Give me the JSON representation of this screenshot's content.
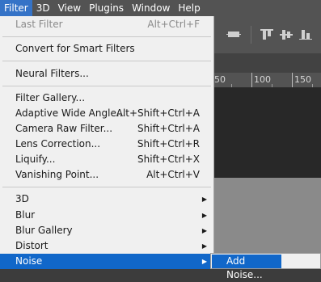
{
  "menubar": {
    "items": [
      "Filter",
      "3D",
      "View",
      "Plugins",
      "Window",
      "Help"
    ],
    "active": "Filter"
  },
  "ruler": {
    "labels": [
      "50",
      "100",
      "150"
    ]
  },
  "filter_menu": {
    "last_filter": {
      "label": "Last Filter",
      "shortcut": "Alt+Ctrl+F",
      "disabled": true
    },
    "convert_smart": {
      "label": "Convert for Smart Filters"
    },
    "neural_filters": {
      "label": "Neural Filters..."
    },
    "filter_gallery": {
      "label": "Filter Gallery..."
    },
    "adaptive_wide_angle": {
      "label": "Adaptive Wide Angle...",
      "shortcut": "Alt+Shift+Ctrl+A"
    },
    "camera_raw": {
      "label": "Camera Raw Filter...",
      "shortcut": "Shift+Ctrl+A"
    },
    "lens_correction": {
      "label": "Lens Correction...",
      "shortcut": "Shift+Ctrl+R"
    },
    "liquify": {
      "label": "Liquify...",
      "shortcut": "Shift+Ctrl+X"
    },
    "vanishing_point": {
      "label": "Vanishing Point...",
      "shortcut": "Alt+Ctrl+V"
    },
    "submenus": [
      "3D",
      "Blur",
      "Blur Gallery",
      "Distort",
      "Noise"
    ],
    "highlighted": "Noise"
  },
  "noise_submenu": {
    "add_noise": "Add Noise..."
  },
  "icons": {
    "submenu_arrow": "triangle-right-icon",
    "align": [
      "align-center-icon",
      "align-top-icon",
      "align-middle-icon",
      "align-bottom-icon"
    ]
  },
  "colors": {
    "highlight": "#1167c9",
    "menubar": "#535353",
    "menu_bg": "#f0f0f0"
  }
}
